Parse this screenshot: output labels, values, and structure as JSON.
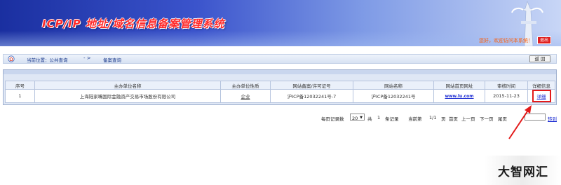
{
  "colors": {
    "banner_dark": "#1a2fa0",
    "title_red": "#ff2a2a",
    "link_blue": "#1b2bd2",
    "highlight_red": "#e31b1b"
  },
  "header": {
    "title": "ICP/IP 地址/域名信息备案管理系统",
    "welcome": "您好，欢迎访问本系统！",
    "exit_label": "退出"
  },
  "location": {
    "prefix": "当前位置：公共查询",
    "separator": "- >",
    "current": "备案查询",
    "back_label": "返 回"
  },
  "table": {
    "columns": [
      "序号",
      "主办单位名称",
      "主办单位性质",
      "网站备案/许可证号",
      "网站名称",
      "网站首页网址",
      "审核时间",
      "详细信息"
    ],
    "rows": [
      {
        "index": "1",
        "org_name": "上海陆家嘴国际金融资产交易市场股份有限公司",
        "org_type": "企业",
        "license_no": "沪ICP备12032241号-7",
        "site_name": "沪ICP备12032241号",
        "site_url": "www.lu.com",
        "audit_time": "2015-11-23",
        "detail": "详细"
      }
    ]
  },
  "pager": {
    "per_page_label": "每页记录数",
    "per_page_value": "20",
    "total_prefix": "共",
    "total_count": "1",
    "total_suffix": "条记录",
    "current_page_label": "当前第",
    "current_page": "1/1",
    "page_unit": "页",
    "first": "首页",
    "prev": "上一页",
    "next": "下一页",
    "last": "尾页",
    "jump_label": "转到"
  },
  "watermark": {
    "text": "大智网汇"
  }
}
